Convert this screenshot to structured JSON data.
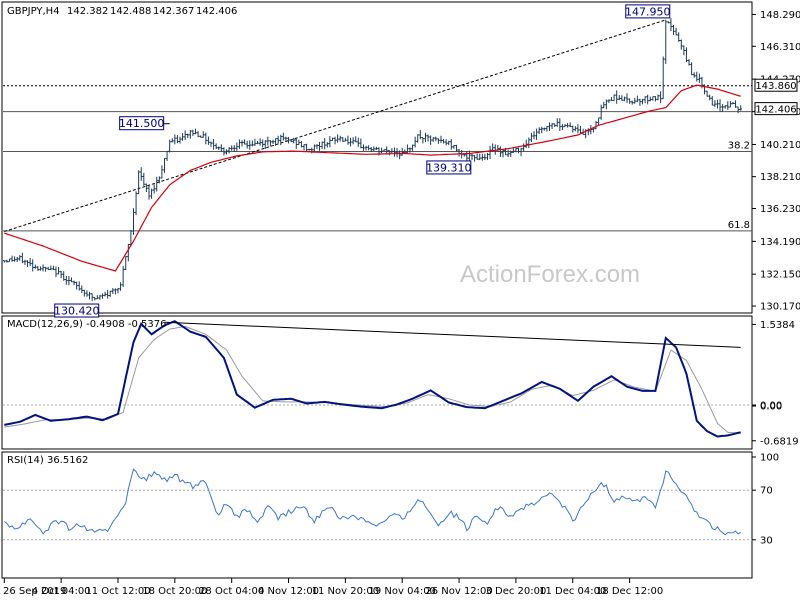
{
  "chart_data": {
    "type": "candlestick",
    "symbol": "GBPJPY,H4",
    "ohlc": {
      "open": "142.382",
      "high": "142.488",
      "low": "142.367",
      "close": "142.406"
    },
    "watermark": "ActionForex.com",
    "colors": {
      "price": "#1b3a57",
      "ma": "#d4000f",
      "macd": "#00137f",
      "signal": "#9a9a9a",
      "rsi": "#3c78c8",
      "frame": "#000000",
      "grid": "#a8a8a8",
      "box": "#000080",
      "watermark": "#c8c8c8"
    },
    "price_panel": {
      "ylim": [
        129.8,
        149.0
      ],
      "yticks": [
        "148.290",
        "146.310",
        "144.270",
        "142.250",
        "140.210",
        "138.210",
        "136.230",
        "134.190",
        "132.150",
        "130.170"
      ],
      "ytick_values": [
        148.29,
        146.31,
        144.27,
        142.25,
        140.21,
        138.21,
        136.23,
        134.19,
        132.15,
        130.17
      ],
      "last_price_label": "142.406",
      "last_price": 142.406,
      "levels": [
        {
          "label": "143.860",
          "value": 143.86,
          "style": "dotted"
        },
        {
          "label": "38.2",
          "value": 139.77,
          "style": "solid"
        },
        {
          "label": "61.8",
          "value": 134.84,
          "style": "solid"
        },
        {
          "label": "",
          "value": 142.25,
          "style": "solid"
        }
      ],
      "annotations": [
        {
          "label": "147.950",
          "value": 147.95,
          "bar": 256
        },
        {
          "label": "141.500",
          "value": 141.5,
          "bar": 64
        },
        {
          "label": "139.310",
          "value": 139.31,
          "bar": 179
        },
        {
          "label": "130.420",
          "value": 130.42,
          "bar": 35
        }
      ],
      "trendline": {
        "from": [
          0,
          134.8
        ],
        "to": [
          256,
          147.95
        ]
      },
      "ma_label": "",
      "ma_values": [
        [
          0,
          134.7
        ],
        [
          15,
          133.9
        ],
        [
          30,
          132.95
        ],
        [
          43,
          132.35
        ],
        [
          50,
          134.2
        ],
        [
          57,
          136.3
        ],
        [
          64,
          137.7
        ],
        [
          72,
          138.6
        ],
        [
          80,
          139.1
        ],
        [
          90,
          139.5
        ],
        [
          100,
          139.75
        ],
        [
          112,
          139.8
        ],
        [
          125,
          139.7
        ],
        [
          140,
          139.6
        ],
        [
          155,
          139.65
        ],
        [
          165,
          139.55
        ],
        [
          180,
          139.65
        ],
        [
          195,
          139.95
        ],
        [
          210,
          140.4
        ],
        [
          222,
          140.8
        ],
        [
          230,
          141.4
        ],
        [
          240,
          141.85
        ],
        [
          250,
          142.3
        ],
        [
          256,
          142.5
        ],
        [
          262,
          143.55
        ],
        [
          268,
          143.9
        ],
        [
          276,
          143.65
        ],
        [
          285,
          143.2
        ]
      ],
      "price_path": [
        [
          0,
          133.0
        ],
        [
          6,
          133.1
        ],
        [
          12,
          132.6
        ],
        [
          20,
          132.3
        ],
        [
          28,
          131.4
        ],
        [
          35,
          130.6
        ],
        [
          40,
          130.9
        ],
        [
          45,
          131.5
        ],
        [
          49,
          134.8
        ],
        [
          52,
          138.5
        ],
        [
          56,
          137.0
        ],
        [
          60,
          138.2
        ],
        [
          64,
          140.4
        ],
        [
          68,
          140.5
        ],
        [
          72,
          141.0
        ],
        [
          76,
          140.8
        ],
        [
          80,
          140.3
        ],
        [
          85,
          139.8
        ],
        [
          90,
          140.2
        ],
        [
          95,
          140.2
        ],
        [
          100,
          140.3
        ],
        [
          106,
          140.6
        ],
        [
          112,
          140.4
        ],
        [
          118,
          139.9
        ],
        [
          124,
          140.3
        ],
        [
          130,
          140.6
        ],
        [
          138,
          140.1
        ],
        [
          145,
          139.8
        ],
        [
          150,
          139.8
        ],
        [
          155,
          139.6
        ],
        [
          160,
          140.7
        ],
        [
          166,
          140.5
        ],
        [
          172,
          140.3
        ],
        [
          179,
          139.4
        ],
        [
          185,
          139.4
        ],
        [
          190,
          140.0
        ],
        [
          195,
          139.6
        ],
        [
          200,
          140.0
        ],
        [
          206,
          141.0
        ],
        [
          212,
          141.5
        ],
        [
          218,
          141.4
        ],
        [
          224,
          140.9
        ],
        [
          228,
          141.3
        ],
        [
          232,
          142.7
        ],
        [
          236,
          143.2
        ],
        [
          242,
          142.9
        ],
        [
          246,
          143.0
        ],
        [
          250,
          143.1
        ],
        [
          254,
          143.1
        ],
        [
          256,
          147.7
        ],
        [
          258,
          147.6
        ],
        [
          262,
          146.3
        ],
        [
          266,
          144.7
        ],
        [
          270,
          144.0
        ],
        [
          274,
          142.6
        ],
        [
          278,
          142.6
        ],
        [
          282,
          142.7
        ],
        [
          285,
          142.3
        ]
      ],
      "volatility": 0.5
    },
    "macd_panel": {
      "header": "MACD(12,26,9) -0.4908 -0.5376",
      "ylim": [
        -0.82,
        1.68
      ],
      "yticks": [
        "1.5384",
        "0.00",
        "0.00",
        "-0.6819"
      ],
      "ytick_values": [
        1.5384,
        0.0,
        0.0,
        -0.6819
      ],
      "macd": [
        [
          0,
          -0.38
        ],
        [
          6,
          -0.32
        ],
        [
          12,
          -0.19
        ],
        [
          18,
          -0.3
        ],
        [
          25,
          -0.27
        ],
        [
          32,
          -0.22
        ],
        [
          38,
          -0.29
        ],
        [
          44,
          -0.17
        ],
        [
          50,
          1.2
        ],
        [
          53,
          1.55
        ],
        [
          57,
          1.35
        ],
        [
          62,
          1.52
        ],
        [
          66,
          1.6
        ],
        [
          72,
          1.4
        ],
        [
          78,
          1.3
        ],
        [
          85,
          0.9
        ],
        [
          90,
          0.2
        ],
        [
          97,
          -0.05
        ],
        [
          104,
          0.1
        ],
        [
          111,
          0.12
        ],
        [
          117,
          0.03
        ],
        [
          124,
          0.06
        ],
        [
          131,
          0.01
        ],
        [
          138,
          -0.03
        ],
        [
          146,
          -0.06
        ],
        [
          152,
          0.01
        ],
        [
          158,
          0.12
        ],
        [
          165,
          0.28
        ],
        [
          172,
          0.05
        ],
        [
          179,
          -0.04
        ],
        [
          186,
          -0.06
        ],
        [
          193,
          0.08
        ],
        [
          200,
          0.22
        ],
        [
          208,
          0.44
        ],
        [
          215,
          0.31
        ],
        [
          222,
          0.08
        ],
        [
          228,
          0.35
        ],
        [
          235,
          0.55
        ],
        [
          241,
          0.35
        ],
        [
          247,
          0.27
        ],
        [
          252,
          0.27
        ],
        [
          256,
          1.28
        ],
        [
          260,
          1.1
        ],
        [
          264,
          0.6
        ],
        [
          268,
          -0.3
        ],
        [
          272,
          -0.5
        ],
        [
          276,
          -0.6
        ],
        [
          280,
          -0.58
        ],
        [
          285,
          -0.52
        ]
      ],
      "signal": [
        [
          0,
          -0.42
        ],
        [
          8,
          -0.36
        ],
        [
          16,
          -0.28
        ],
        [
          24,
          -0.28
        ],
        [
          32,
          -0.25
        ],
        [
          40,
          -0.27
        ],
        [
          46,
          -0.14
        ],
        [
          52,
          0.9
        ],
        [
          58,
          1.25
        ],
        [
          64,
          1.45
        ],
        [
          70,
          1.5
        ],
        [
          78,
          1.35
        ],
        [
          86,
          1.05
        ],
        [
          92,
          0.55
        ],
        [
          100,
          0.08
        ],
        [
          108,
          0.06
        ],
        [
          116,
          0.06
        ],
        [
          124,
          0.05
        ],
        [
          132,
          0.02
        ],
        [
          140,
          -0.01
        ],
        [
          148,
          -0.03
        ],
        [
          156,
          0.04
        ],
        [
          164,
          0.2
        ],
        [
          172,
          0.12
        ],
        [
          180,
          0.0
        ],
        [
          188,
          -0.03
        ],
        [
          196,
          0.06
        ],
        [
          204,
          0.3
        ],
        [
          212,
          0.38
        ],
        [
          220,
          0.18
        ],
        [
          228,
          0.28
        ],
        [
          236,
          0.48
        ],
        [
          244,
          0.34
        ],
        [
          252,
          0.26
        ],
        [
          258,
          1.05
        ],
        [
          264,
          0.85
        ],
        [
          270,
          0.3
        ],
        [
          276,
          -0.35
        ],
        [
          280,
          -0.52
        ],
        [
          285,
          -0.54
        ]
      ],
      "trendline": {
        "from": [
          62,
          1.58
        ],
        "to": [
          285,
          1.1
        ]
      }
    },
    "rsi_panel": {
      "header": "RSI(14) 36.5162",
      "ylim": [
        0,
        100
      ],
      "yticks": [
        "100",
        "70",
        "30"
      ],
      "ytick_values": [
        100,
        70,
        30
      ],
      "levels": [
        70,
        30
      ],
      "values": [
        [
          0,
          45
        ],
        [
          5,
          39
        ],
        [
          10,
          48
        ],
        [
          15,
          36
        ],
        [
          20,
          46
        ],
        [
          25,
          40
        ],
        [
          30,
          42
        ],
        [
          35,
          35
        ],
        [
          40,
          38
        ],
        [
          44,
          52
        ],
        [
          47,
          60
        ],
        [
          50,
          86
        ],
        [
          54,
          78
        ],
        [
          58,
          84
        ],
        [
          62,
          78
        ],
        [
          66,
          82
        ],
        [
          70,
          75
        ],
        [
          74,
          72
        ],
        [
          78,
          78
        ],
        [
          82,
          50
        ],
        [
          86,
          58
        ],
        [
          90,
          48
        ],
        [
          94,
          54
        ],
        [
          98,
          45
        ],
        [
          102,
          56
        ],
        [
          106,
          48
        ],
        [
          110,
          52
        ],
        [
          115,
          57
        ],
        [
          120,
          45
        ],
        [
          125,
          58
        ],
        [
          130,
          47
        ],
        [
          135,
          50
        ],
        [
          140,
          46
        ],
        [
          145,
          42
        ],
        [
          150,
          50
        ],
        [
          155,
          47
        ],
        [
          160,
          64
        ],
        [
          164,
          55
        ],
        [
          168,
          42
        ],
        [
          172,
          52
        ],
        [
          176,
          48
        ],
        [
          179,
          38
        ],
        [
          183,
          50
        ],
        [
          187,
          45
        ],
        [
          192,
          58
        ],
        [
          196,
          48
        ],
        [
          200,
          56
        ],
        [
          205,
          58
        ],
        [
          210,
          67
        ],
        [
          215,
          62
        ],
        [
          220,
          45
        ],
        [
          224,
          57
        ],
        [
          228,
          70
        ],
        [
          232,
          75
        ],
        [
          236,
          62
        ],
        [
          240,
          66
        ],
        [
          244,
          60
        ],
        [
          248,
          66
        ],
        [
          252,
          56
        ],
        [
          256,
          85
        ],
        [
          260,
          75
        ],
        [
          264,
          64
        ],
        [
          268,
          50
        ],
        [
          272,
          45
        ],
        [
          276,
          38
        ],
        [
          280,
          35
        ],
        [
          285,
          36
        ]
      ],
      "noise": 5
    },
    "x_axis": {
      "labels": [
        "26 Sep 2019",
        "4 Oct 04:00",
        "11 Oct 12:00",
        "18 Oct 20:00",
        "28 Oct 04:00",
        "4 Nov 12:00",
        "11 Nov 20:00",
        "19 Nov 04:00",
        "26 Nov 12:00",
        "3 Dec 20:00",
        "11 Dec 04:00",
        "18 Dec 12:00"
      ],
      "label_bars": [
        0,
        22,
        44,
        66,
        88,
        110,
        132,
        154,
        176,
        198,
        220,
        242
      ],
      "bar_count": 286
    }
  }
}
